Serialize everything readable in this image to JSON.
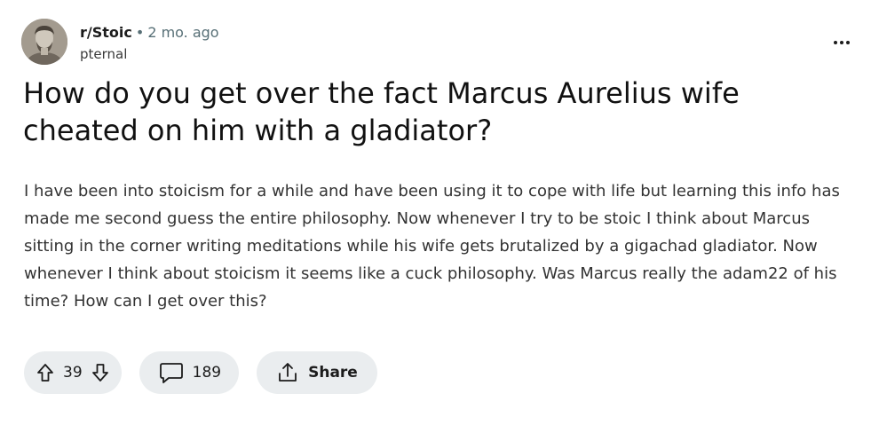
{
  "post": {
    "subreddit": "r/Stoic",
    "separator": "•",
    "age": "2 mo. ago",
    "author": "pternal",
    "title": "How do you get over the fact Marcus Aurelius wife cheated on him with a gladiator?",
    "body": "I have been into stoicism for a while and have been using it to cope with life but learning this info has made me second guess the entire philosophy. Now whenever I try to be stoic I think about Marcus sitting in the corner writing meditations while his wife gets brutalized by a gigachad gladiator. Now whenever I think about stoicism it seems like a cuck philosophy. Was Marcus really the adam22 of his time? How can I get over this?"
  },
  "actions": {
    "votes": "39",
    "comments": "189",
    "share_label": "Share"
  },
  "icons": {
    "avatar": "marcus-aurelius-bust-avatar",
    "more": "more-options-icon",
    "upvote": "upvote-arrow-icon",
    "downvote": "downvote-arrow-icon",
    "comment": "comment-bubble-icon",
    "share": "share-icon"
  },
  "colors": {
    "background": "#ffffff",
    "pill_background": "#eaedef",
    "text": "#1c1c1c",
    "muted": "#576f76"
  }
}
